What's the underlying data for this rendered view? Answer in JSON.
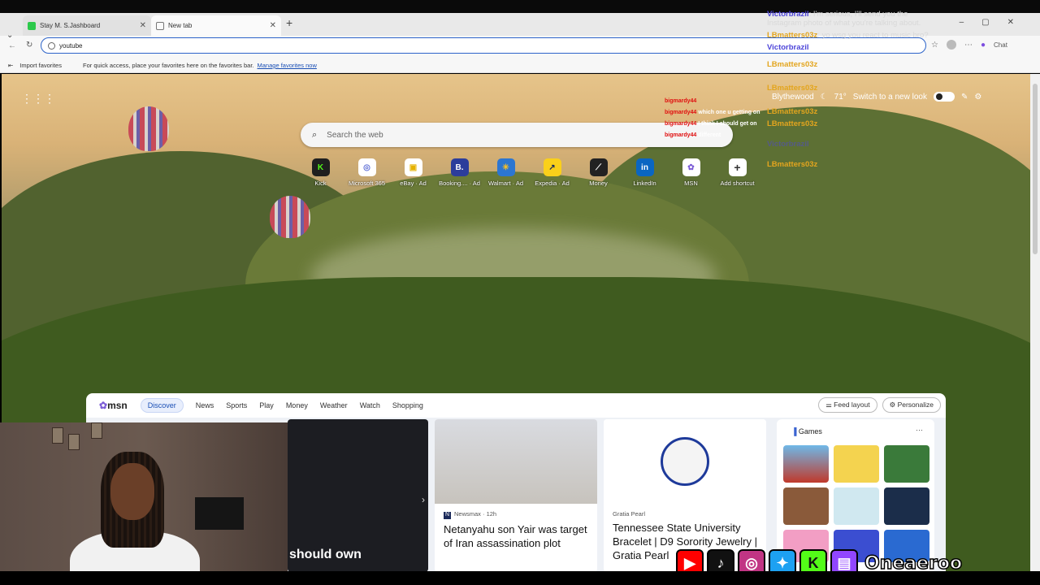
{
  "browser": {
    "tabs": [
      {
        "title": "Stay M. S.Jashboard"
      },
      {
        "title": "New tab"
      }
    ],
    "address_value": "youtube",
    "favbar": {
      "import_label": "Import favorites",
      "hint": "For quick access, place your favorites here on the favorites bar.",
      "manage_link": "Manage favorites now"
    },
    "chat_button": "Chat"
  },
  "newtab": {
    "weather": {
      "location": "Blythewood",
      "temp": "71°",
      "switch_label": "Switch to a new look"
    },
    "search_placeholder": "Search the web",
    "shortcuts": [
      {
        "label": "Kick",
        "icon": "kick-icon",
        "color": "#1f1f1f",
        "glyph": "K"
      },
      {
        "label": "Microsoft 365",
        "icon": "microsoft-365-icon",
        "color": "#5f6fd6",
        "glyph": "◎"
      },
      {
        "label": "eBay · Ad",
        "icon": "ebay-icon",
        "color": "#ffffff",
        "glyph": "🛍"
      },
      {
        "label": "Booking.... · Ad",
        "icon": "booking-icon",
        "color": "#2c3d9b",
        "glyph": "B."
      },
      {
        "label": "Walmart · Ad",
        "icon": "walmart-icon",
        "color": "#2c76d1",
        "glyph": "✳"
      },
      {
        "label": "Expedia · Ad",
        "icon": "expedia-icon",
        "color": "#fad01a",
        "glyph": "↗"
      },
      {
        "label": "Money",
        "icon": "money-icon",
        "color": "#222222",
        "glyph": "📈"
      },
      {
        "label": "LinkedIn",
        "icon": "linkedin-icon",
        "color": "#0a66c2",
        "glyph": "in"
      },
      {
        "label": "MSN",
        "icon": "msn-icon",
        "color": "#ffffff",
        "glyph": "✿"
      },
      {
        "label": "Add shortcut",
        "icon": "plus-icon",
        "color": "#ffffff",
        "glyph": "+"
      }
    ]
  },
  "chat_overlay": [
    {
      "user": "Victorbrazil",
      "text": ": I'm serious, I'll send you the Instagram photo of what you're talking about.",
      "color": "#4d45d9"
    },
    {
      "user": "LBmatters03z",
      "text": ": yo wsg you react to music bro?",
      "color": "#e3a51e"
    },
    {
      "user": "Victorbrazil",
      "text": "",
      "color": "#4d45d9"
    },
    {
      "user": "LBmatters03z",
      "text": "",
      "color": "#e3a51e"
    },
    {
      "user": "LBmatters03z",
      "text": "",
      "color": "#e3a51e"
    },
    {
      "user": "LBmatters03z",
      "text": "",
      "color": "#e3a51e"
    },
    {
      "user": "LBmatters03z",
      "text": "",
      "color": "#e3a51e"
    },
    {
      "user": "Victorbrazil",
      "text": "",
      "color": "#4d45d9"
    },
    {
      "user": "LBmatters03z",
      "text": "",
      "color": "#e3a51e"
    }
  ],
  "red_chat": [
    {
      "user": "bigmardy44",
      "text": ""
    },
    {
      "user": "bigmardy44",
      "text": "which one u getting on"
    },
    {
      "user": "bigmardy44",
      "text": "I think I should get on"
    },
    {
      "user": "bigmardy44",
      "text": "different"
    }
  ],
  "msn": {
    "logo": "msn",
    "nav": [
      "Discover",
      "News",
      "Sports",
      "Play",
      "Money",
      "Weather",
      "Watch",
      "Shopping"
    ],
    "feed_layout": "Feed layout",
    "personalize": "Personalize",
    "cards": [
      {
        "source": "",
        "headline": "should own"
      },
      {
        "source": "Newsmax · 12h",
        "headline": "Netanyahu son Yair was target of Iran assassination plot"
      },
      {
        "source": "Gratia Pearl",
        "headline": "Tennessee State University Bracelet | D9 Sorority Jewelry | Gratia Pearl"
      }
    ],
    "games_title": "Games"
  },
  "stream": {
    "handle": "Oneaeroo",
    "socials": [
      {
        "name": "youtube-icon",
        "color": "#ff0000",
        "glyph": "▶"
      },
      {
        "name": "tiktok-icon",
        "color": "#111111",
        "glyph": "♪"
      },
      {
        "name": "instagram-icon",
        "color": "#c13584",
        "glyph": "◎"
      },
      {
        "name": "twitter-icon",
        "color": "#1da1f2",
        "glyph": "🐦"
      },
      {
        "name": "kick-icon",
        "color": "#53fc18",
        "glyph": "K"
      },
      {
        "name": "twitch-icon",
        "color": "#9146ff",
        "glyph": "▤"
      }
    ]
  }
}
